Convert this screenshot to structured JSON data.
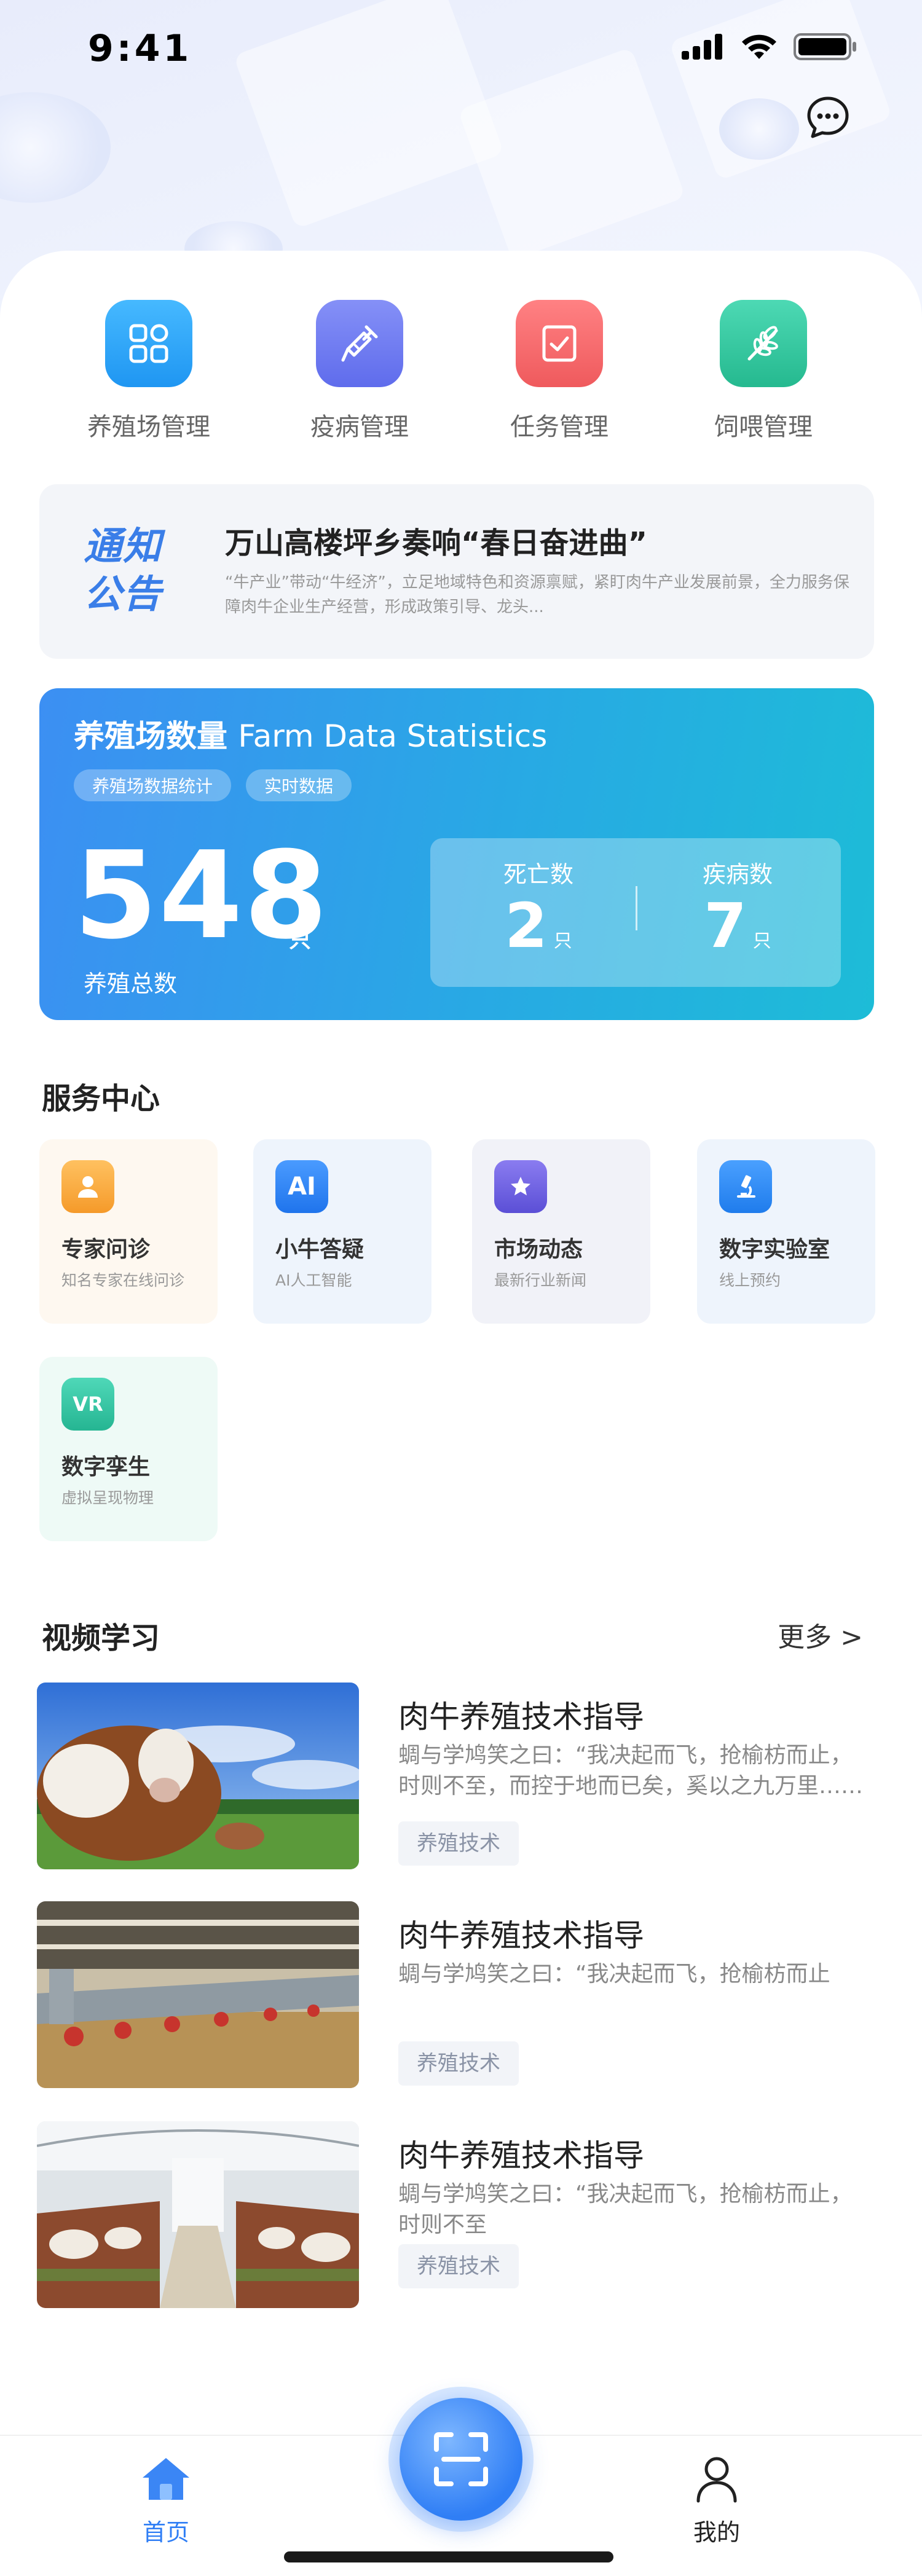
{
  "status_bar": {
    "time": "9:41"
  },
  "quick_nav": [
    {
      "label": "养殖场管理",
      "icon": "grid-apps-icon",
      "color": "#2aa6f7"
    },
    {
      "label": "疫病管理",
      "icon": "syringe-icon",
      "color": "#6f7ef3"
    },
    {
      "label": "任务管理",
      "icon": "checkbox-icon",
      "color": "#f4676a"
    },
    {
      "label": "饲喂管理",
      "icon": "wheat-icon",
      "color": "#36c9a2"
    }
  ],
  "notice": {
    "tag": "通知公告",
    "title": "万山高楼坪乡奏响“春日奋进曲”",
    "desc": "“牛产业”带动“牛经济”，立足地域特色和资源禀赋，紧盯肉牛产业发展前景，全力服务保障肉牛企业生产经营，形成政策引导、龙头..."
  },
  "stats": {
    "title": "养殖场数量",
    "title_en": "Farm Data Statistics",
    "chips": [
      "养殖场数据统计",
      "实时数据"
    ],
    "total": "548",
    "total_unit": "只",
    "total_label": "养殖总数",
    "death_label": "死亡数",
    "death_value": "2",
    "death_unit": "只",
    "disease_label": "疾病数",
    "disease_value": "7",
    "disease_unit": "只"
  },
  "service_center": {
    "title": "服务中心",
    "items": [
      {
        "name": "专家问诊",
        "desc": "知名专家在线问诊",
        "icon": "expert-icon",
        "glyph": "",
        "color": "#f7a93b",
        "bg": "#fef8f0"
      },
      {
        "name": "小牛答疑",
        "desc": "AI人工智能",
        "icon": "ai-icon",
        "glyph": "AI",
        "color": "#2b7ff2",
        "bg": "#eef4fc"
      },
      {
        "name": "市场动态",
        "desc": "最新行业新闻",
        "icon": "star-badge-icon",
        "glyph": "",
        "color": "#6b62e0",
        "bg": "#f1f2f8"
      },
      {
        "name": "数字实验室",
        "desc": "线上预约",
        "icon": "microscope-icon",
        "glyph": "",
        "color": "#2b8cf2",
        "bg": "#eef4fc"
      },
      {
        "name": "数字孪生",
        "desc": "虚拟呈现物理",
        "icon": "vr-icon",
        "glyph": "VR",
        "color": "#2fbfa0",
        "bg": "#eefaf6"
      }
    ]
  },
  "video_learning": {
    "title": "视频学习",
    "more": "更多 >",
    "items": [
      {
        "title": "肉牛养殖技术指导",
        "desc": "蜩与学鸠笑之曰：“我决起而飞，抢榆枋而止，时则不至，而控于地而已矣，奚以之九万里……",
        "tag": "养殖技术"
      },
      {
        "title": "肉牛养殖技术指导",
        "desc": "蜩与学鸠笑之曰：“我决起而飞，抢榆枋而止",
        "tag": "养殖技术"
      },
      {
        "title": "肉牛养殖技术指导",
        "desc": "蜩与学鸠笑之曰：“我决起而飞，抢榆枋而止，时则不至",
        "tag": "养殖技术"
      }
    ]
  },
  "tabbar": {
    "home": "首页",
    "mine": "我的",
    "active_color": "#2f7ef5"
  }
}
